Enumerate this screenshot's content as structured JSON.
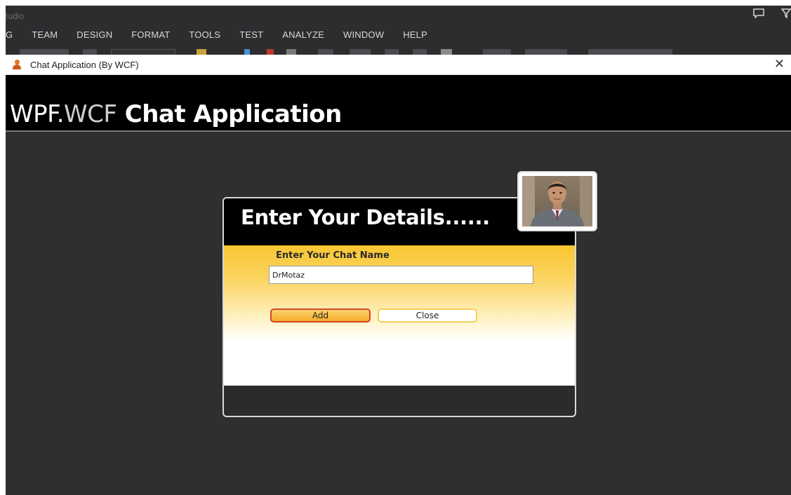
{
  "ide": {
    "title": "tudio",
    "menu": [
      "G",
      "TEAM",
      "DESIGN",
      "FORMAT",
      "TOOLS",
      "TEST",
      "ANALYZE",
      "WINDOW",
      "HELP"
    ],
    "right_icons": [
      "feedback-icon",
      "filter-icon"
    ]
  },
  "window": {
    "title": "Chat Application (By WCF)",
    "icon": "user-icon",
    "close_glyph": "✕"
  },
  "header": {
    "part1": "WPF.",
    "part2": "WCF",
    "part3": " Chat Application"
  },
  "dialog": {
    "title": "Enter Your Details......",
    "field_label": "Enter Your Chat Name",
    "chat_name_value": "DrMotaz",
    "add_label": "Add",
    "close_label": "Close"
  },
  "colors": {
    "app_background": "#2f2f2f",
    "header_background": "#000000",
    "form_gradient_top": "#f9c631",
    "add_button_border": "#d2452a",
    "close_button_border": "#f4cf58"
  }
}
